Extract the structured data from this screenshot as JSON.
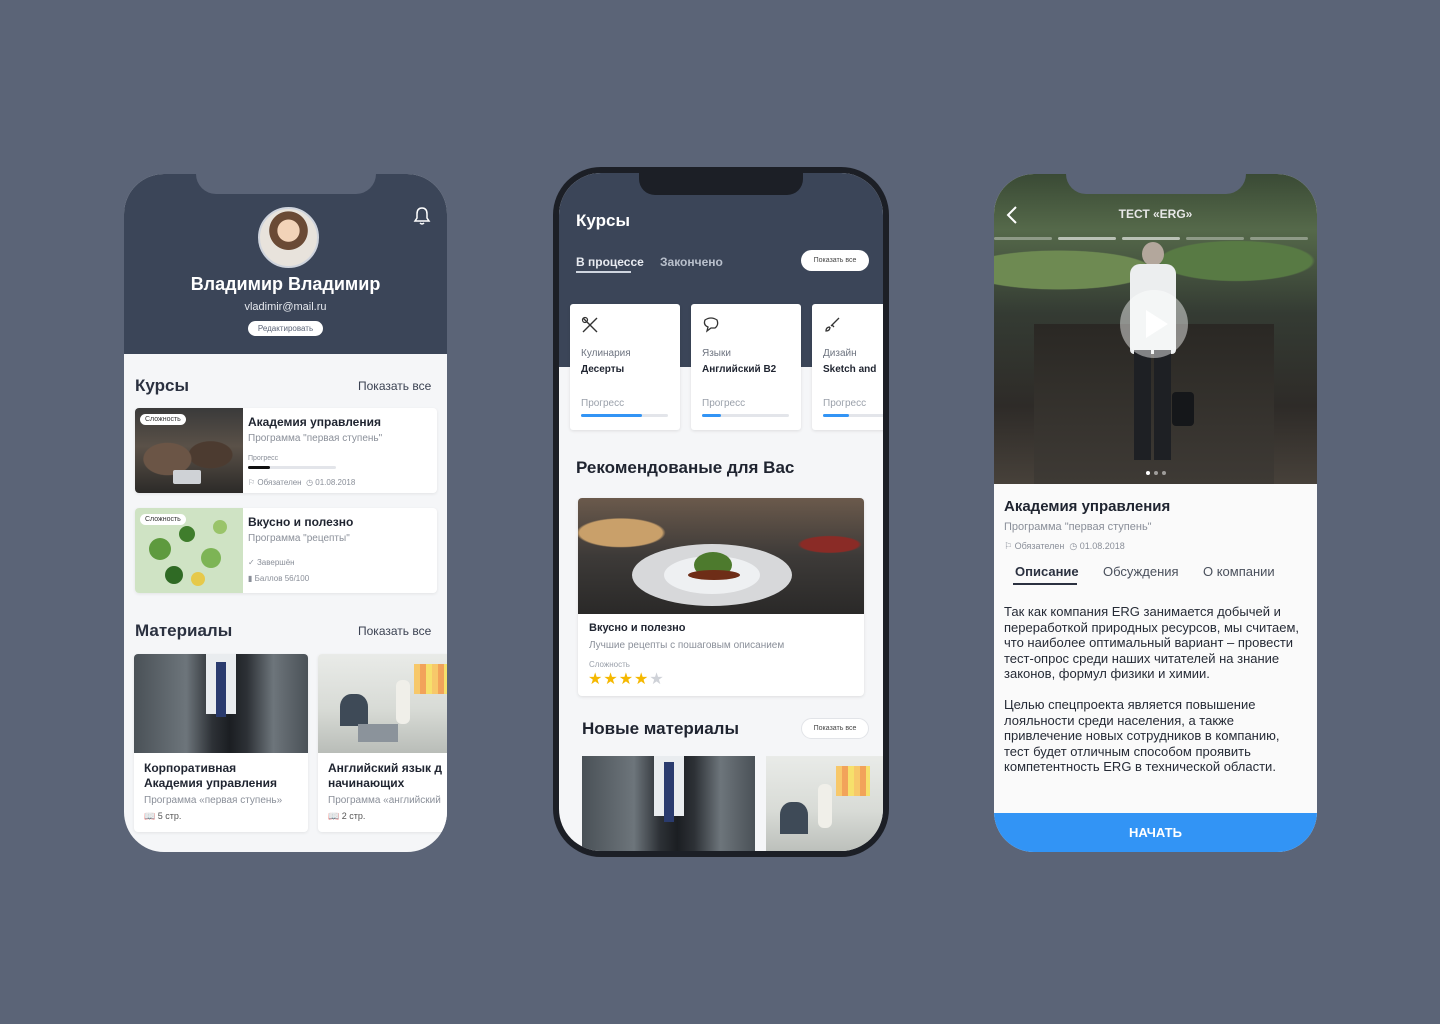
{
  "profile": {
    "name": "Владимир Владимир",
    "email": "vladimir@mail.ru",
    "edit_label": "Редактировать",
    "courses_title": "Курсы",
    "show_all": "Показать все",
    "courses": [
      {
        "badge": "Сложность",
        "title": "Академия управления",
        "subtitle": "Программа \"первая ступень\"",
        "progress_label": "Прогресс",
        "progress": 0.25,
        "required": "Обязателен",
        "date": "01.08.2018"
      },
      {
        "badge": "Сложность",
        "title": "Вкусно и полезно",
        "subtitle": "Программа \"рецепты\"",
        "status": "Завершён",
        "score": "Баллов 56/100"
      }
    ],
    "materials_title": "Материалы",
    "materials": [
      {
        "title": "Корпоративная\nАкадемия управления",
        "subtitle": "Программа «первая ступень»",
        "pages": "5 стр."
      },
      {
        "title": "Английский язык д\nначинающих",
        "subtitle": "Программа «английский",
        "pages": "2 стр."
      }
    ]
  },
  "courses_screen": {
    "title": "Курсы",
    "tab_active": "В процессе",
    "tab_inactive": "Закончено",
    "show_all": "Показать все",
    "cards": [
      {
        "icon": "tools-icon",
        "category": "Кулинария",
        "name": "Десерты",
        "progress_label": "Прогресс",
        "progress": 0.7
      },
      {
        "icon": "chat-icon",
        "category": "Языки",
        "name": "Английский B2",
        "progress_label": "Прогресс",
        "progress": 0.22
      },
      {
        "icon": "brush-icon",
        "category": "Дизайн",
        "name": "Sketch and",
        "progress_label": "Прогресс",
        "progress": 0.3
      }
    ],
    "recommended_title": "Рекомендованые для Вас",
    "recommended": {
      "title": "Вкусно и полезно",
      "subtitle": "Лучшие рецепты с пошаговым описанием",
      "difficulty_label": "Сложность",
      "stars": "★★★★",
      "stars_off": "★",
      "rating": 4
    },
    "new_title": "Новые материалы",
    "show_all_2": "Показать все"
  },
  "detail": {
    "title": "ТЕСТ «ERG»",
    "course_title": "Академия управления",
    "course_subtitle": "Программа \"первая ступень\"",
    "required": "Обязателен",
    "date": "01.08.2018",
    "tabs": [
      "Описание",
      "Обсуждения",
      "О компании"
    ],
    "description": "Так как компания ERG занимается добычей и\nпереработкой природных ресурсов, мы считаем,\nчто наиболее оптимальный вариант – провести\nтест-опрос среди наших читателей на знание\nзаконов, формул физики и химии.\n\nЦелью спецпроекта является повышение\nлояльности среди населения, а также\nпривлечение новых сотрудников в компанию,\nтест будет отличным способом проявить\nкомпетентность ERG в технической области.",
    "start_label": "НАЧАТЬ"
  },
  "colors": {
    "background": "#5b6477",
    "header": "#3b4558",
    "accent": "#3294f5",
    "star": "#f5b800"
  }
}
